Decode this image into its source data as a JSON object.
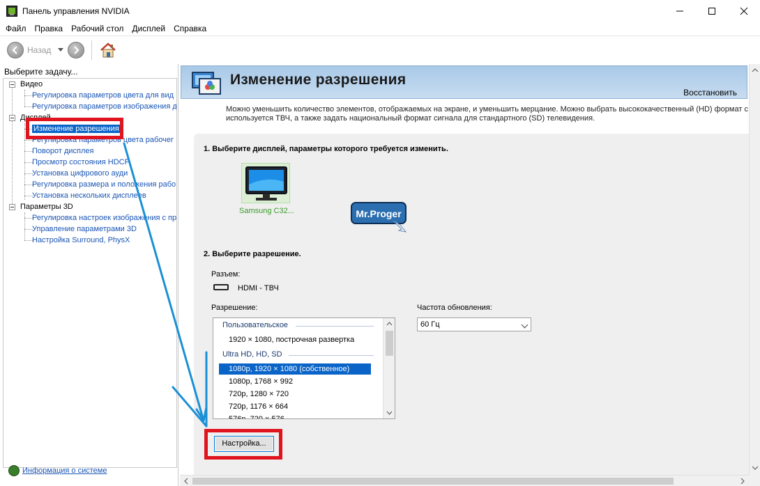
{
  "window": {
    "title": "Панель управления NVIDIA",
    "controls": [
      "minimize",
      "maximize",
      "close"
    ]
  },
  "menu": [
    "Файл",
    "Правка",
    "Рабочий стол",
    "Дисплей",
    "Справка"
  ],
  "toolbar": {
    "back_label": "Назад",
    "icons": [
      "back-arrow-icon",
      "forward-arrow-icon",
      "home-icon"
    ]
  },
  "sidebar": {
    "caption": "Выберите задачу...",
    "categories": [
      {
        "label": "Видео",
        "items": [
          "Регулировка параметров цвета для вид",
          "Регулировка параметров изображения д"
        ]
      },
      {
        "label": "Дисплей",
        "items": [
          "Изменение разрешения",
          "Регулировка параметров цвета рабочег",
          "Поворот дисплея",
          "Просмотр состояния HDCP",
          "Установка цифрового ауди",
          "Регулировка размера и положения рабо",
          "Установка нескольких дисплеев"
        ]
      },
      {
        "label": "Параметры 3D",
        "items": [
          "Регулировка настроек изображения с пр",
          "Управление параметрами 3D",
          "Настройка Surround, PhysX"
        ]
      }
    ],
    "selected": "Изменение разрешения",
    "system_info": "Информация о системе"
  },
  "page": {
    "title": "Изменение разрешения",
    "restore": "Восстановить",
    "description_lines": [
      "Можно уменьшить количество элементов, отображаемых на экране, и уменьшить мерцание. Можно выбрать высококачественный (HD) формат с",
      "используется ТВЧ, а также задать национальный формат сигнала для стандартного (SD) телевидения."
    ],
    "step1": "1. Выберите дисплей, параметры которого требуется изменить.",
    "display_name": "Samsung C32...",
    "watermark": "Mr.Proger",
    "step2": "2. Выберите разрешение.",
    "connector_label": "Разъем:",
    "connector_value": "HDMI - ТВЧ",
    "resolution_label": "Разрешение:",
    "refresh_label": "Частота обновления:",
    "refresh_value": "60 Гц",
    "resolution_groups": [
      {
        "group": "Пользовательское",
        "items": [
          "1920 × 1080, построчная развертка"
        ]
      },
      {
        "group": "Ultra HD, HD, SD",
        "items": [
          "1080p, 1920 × 1080 (собственное)",
          "1080p, 1768 × 992",
          "720p, 1280 × 720",
          "720p, 1176 × 664",
          "576p, 720 × 576"
        ]
      }
    ],
    "selected_resolution": "1080p, 1920 × 1080 (собственное)",
    "settings_button": "Настройка..."
  },
  "colors": {
    "accent": "#0a64c8",
    "highlight_box": "#e0141e",
    "annotation_arrow": "#1a8fd6",
    "link": "#1a55b5"
  }
}
